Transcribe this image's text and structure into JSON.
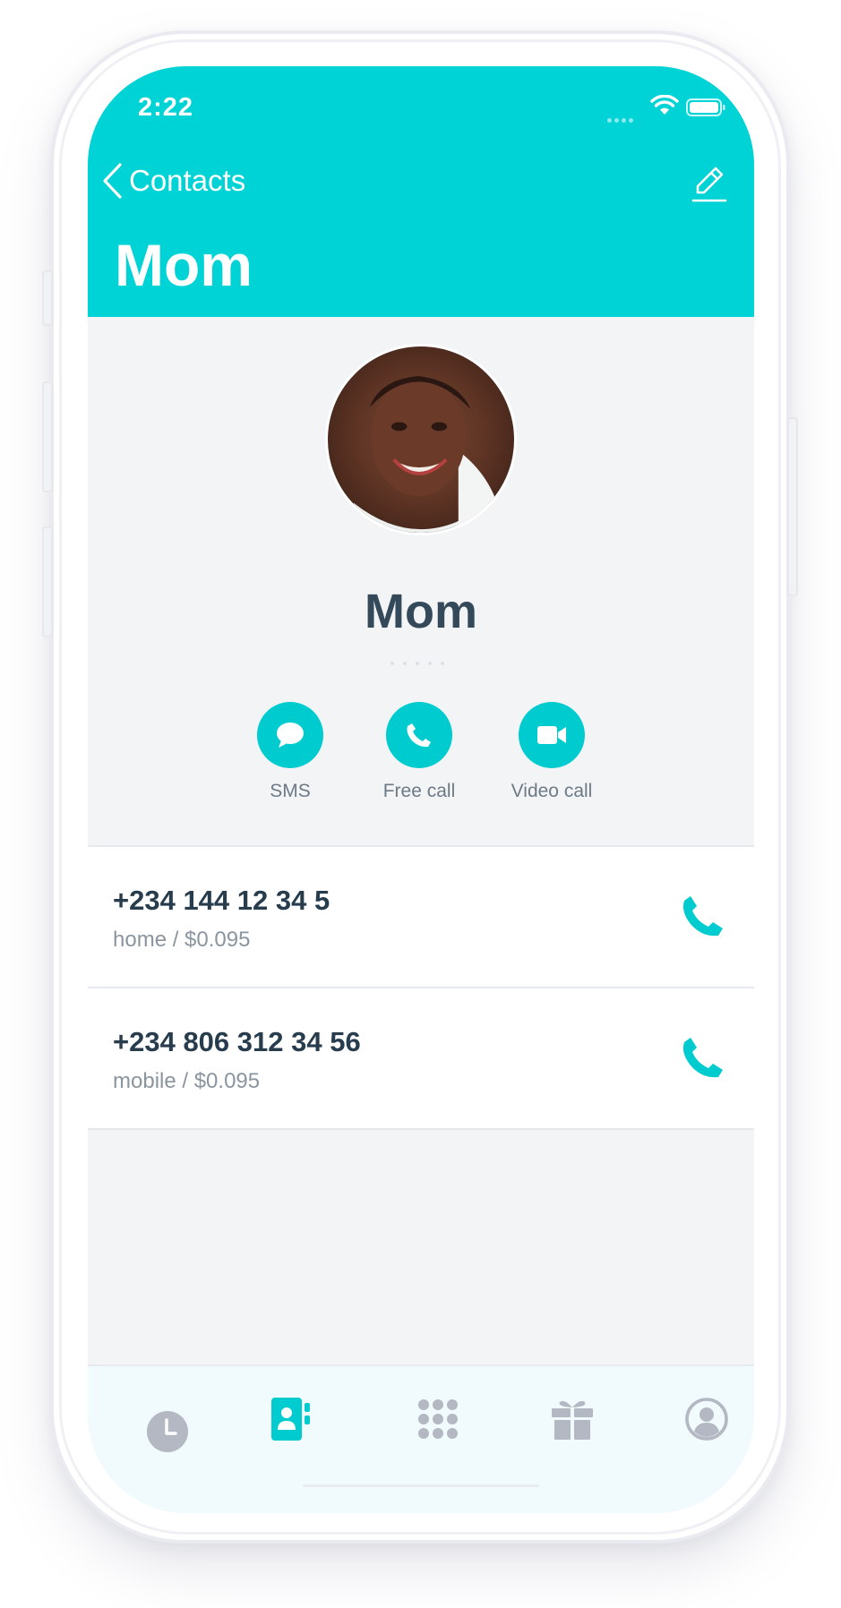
{
  "status_bar": {
    "time": "2:22"
  },
  "nav": {
    "back_label": "Contacts",
    "large_title": "Mom"
  },
  "contact": {
    "name": "Mom"
  },
  "actions": [
    {
      "label": "SMS",
      "icon": "chat-bubble-icon"
    },
    {
      "label": "Free call",
      "icon": "phone-icon"
    },
    {
      "label": "Video call",
      "icon": "video-camera-icon"
    }
  ],
  "phones": [
    {
      "number": "+234 144 12 34 5",
      "meta": "home / $0.095"
    },
    {
      "number": "+234 806 312 34 56",
      "meta": "mobile / $0.095"
    }
  ],
  "tabbar": {
    "tabs": [
      {
        "name": "recents",
        "icon": "clock-icon",
        "active": false
      },
      {
        "name": "contacts",
        "icon": "contact-book-icon",
        "active": true
      },
      {
        "name": "keypad",
        "icon": "keypad-icon",
        "active": false
      },
      {
        "name": "rewards",
        "icon": "gift-icon",
        "active": false
      },
      {
        "name": "profile",
        "icon": "user-circle-icon",
        "active": false
      }
    ]
  },
  "colors": {
    "accent": "#00d3d5",
    "text_dark": "#344a5a",
    "text_muted": "#8a95a0",
    "tab_inactive": "#b3b8c2",
    "background": "#f3f4f6"
  }
}
